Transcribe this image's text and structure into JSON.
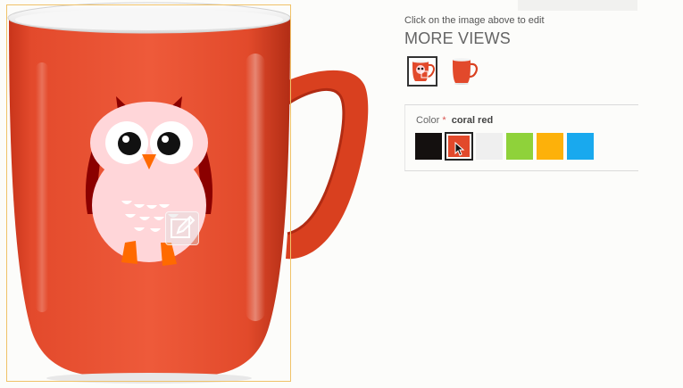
{
  "product_image": {
    "edit_icon": "pencil-edit-icon"
  },
  "edit_hint": "Click on the image above to edit",
  "more_views": {
    "title": "MORE VIEWS",
    "thumbnails": [
      {
        "name": "mug-owl-thumbnail",
        "selected": true
      },
      {
        "name": "mug-plain-thumbnail",
        "selected": false
      }
    ]
  },
  "color_option": {
    "label": "Color",
    "required_mark": "*",
    "selected_value": "coral red",
    "swatches": [
      {
        "name": "black",
        "color": "#14100f"
      },
      {
        "name": "coral red",
        "color": "#e2492b",
        "selected": true
      },
      {
        "name": "white",
        "color": "#efefef"
      },
      {
        "name": "lime green",
        "color": "#8fd23a"
      },
      {
        "name": "amber",
        "color": "#fdb10a"
      },
      {
        "name": "sky blue",
        "color": "#19a9ee"
      }
    ]
  },
  "colors": {
    "mug": "#e2492b",
    "frame": "#f0c268",
    "owl_body": "#ffd6d9",
    "owl_wing": "#8b0000",
    "owl_feet": "#ff6a00"
  }
}
